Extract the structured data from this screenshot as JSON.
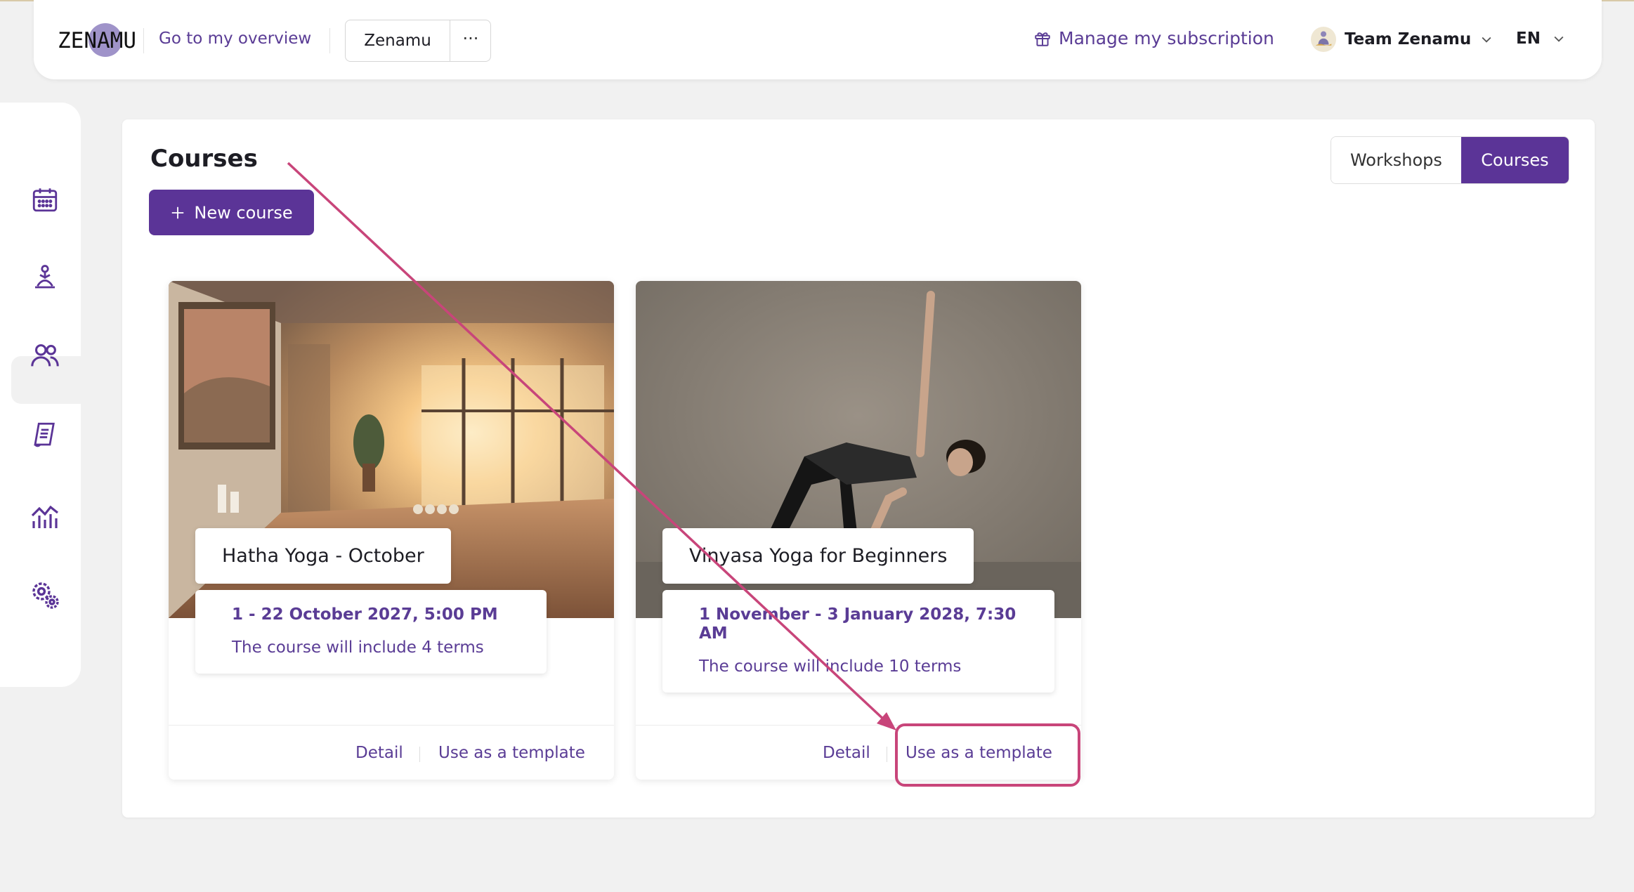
{
  "header": {
    "logo_text": "ZENAMU",
    "overview_link": "Go to my overview",
    "workspace_name": "Zenamu",
    "workspace_more": "···",
    "subscription_link": "Manage my subscription",
    "team_name": "Team Zenamu",
    "language": "EN"
  },
  "sidebar": {
    "items": [
      {
        "icon": "calendar-icon"
      },
      {
        "icon": "meditation-icon",
        "active": true
      },
      {
        "icon": "users-icon"
      },
      {
        "icon": "document-icon"
      },
      {
        "icon": "statistics-icon"
      },
      {
        "icon": "settings-icon"
      }
    ]
  },
  "main": {
    "title": "Courses",
    "new_button": "New course",
    "toggle": {
      "option_a": "Workshops",
      "option_b": "Courses",
      "selected": "Courses"
    }
  },
  "courses": [
    {
      "title": "Hatha Yoga - October",
      "date": "1 - 22 October 2027, 5:00 PM",
      "terms": "The course will include 4 terms",
      "detail_link": "Detail",
      "template_link": "Use as a template"
    },
    {
      "title": "Vinyasa Yoga for Beginners",
      "date": "1 November - 3 January 2028, 7:30 AM",
      "terms": "The course will include 10 terms",
      "detail_link": "Detail",
      "template_link": "Use as a template"
    }
  ],
  "colors": {
    "brand": "#5b3497",
    "link": "#5a3c95",
    "annotation": "#c8457a"
  }
}
